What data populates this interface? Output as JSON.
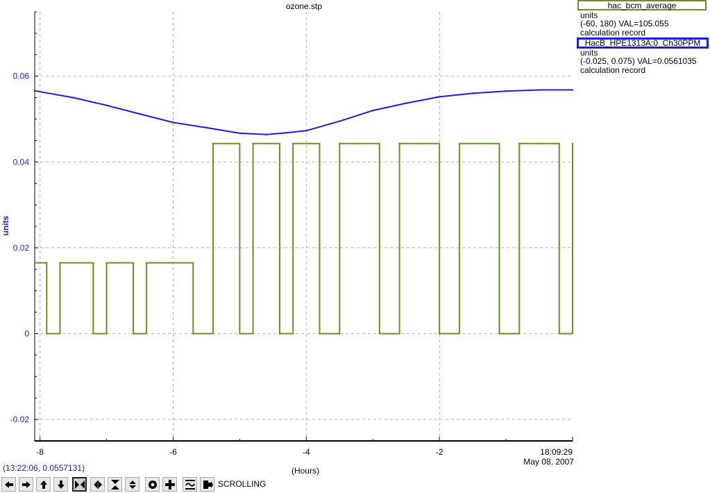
{
  "chart_data": {
    "type": "line",
    "title": "ozone.stp",
    "xlabel": "(Hours)",
    "ylabel": "units",
    "xlim": [
      -8.08,
      0
    ],
    "ylim": [
      -0.025,
      0.075
    ],
    "x_ticks": [
      -8,
      -6,
      -4,
      -2
    ],
    "x_tick_labels": [
      "-8",
      "-6",
      "-4",
      "-2"
    ],
    "y_ticks": [
      -0.02,
      0,
      0.02,
      0.04,
      0.06
    ],
    "y_tick_labels": [
      "-0.02",
      "0",
      "0.02",
      "0.04",
      "0.06"
    ],
    "end_time": "18:09:29",
    "end_date": "May 08, 2007",
    "grid": true,
    "series": [
      {
        "name": "HacB_HPE1313A:0_Ch30PPM",
        "color": "#1a1ae6",
        "x": [
          -8.08,
          -7.5,
          -7.0,
          -6.5,
          -6.0,
          -5.5,
          -5.0,
          -4.6,
          -4.3,
          -4.0,
          -3.5,
          -3.0,
          -2.5,
          -2.0,
          -1.5,
          -1.0,
          -0.5,
          0
        ],
        "values": [
          0.0566,
          0.055,
          0.0532,
          0.0512,
          0.0492,
          0.048,
          0.0467,
          0.0464,
          0.0468,
          0.0473,
          0.0495,
          0.052,
          0.0537,
          0.0552,
          0.056,
          0.0565,
          0.0568,
          0.0568
        ]
      },
      {
        "name": "hac_bcm_average",
        "color": "#6b8e23",
        "x": [
          -8.08,
          -7.9,
          -7.7,
          -7.5,
          -7.2,
          -7.0,
          -6.6,
          -6.4,
          -6.0,
          -5.7,
          -5.45,
          -5.4,
          -5.2,
          -5.0,
          -4.8,
          -4.6,
          -4.4,
          -4.2,
          -4.0,
          -3.8,
          -3.5,
          -3.2,
          -2.9,
          -2.6,
          -2.3,
          -2.0,
          -1.7,
          -1.4,
          -1.1,
          -0.8,
          -0.5,
          -0.2,
          0
        ],
        "values": [
          0.0165,
          0,
          0.0165,
          0.0165,
          0,
          0.0165,
          0,
          0.0165,
          0.0165,
          0,
          0,
          0.0443,
          0.0443,
          0,
          0.0443,
          0.0443,
          0,
          0.0443,
          0.0443,
          0,
          0.0443,
          0.0443,
          0,
          0.0443,
          0.0443,
          0,
          0.0443,
          0.0443,
          0,
          0.0443,
          0.0443,
          0,
          0.0443
        ]
      }
    ]
  },
  "legend": {
    "item1": {
      "name": "hac_bcm_average",
      "units": "units",
      "range": "(-60, 180) VAL=105.055",
      "desc": "calculation record",
      "color": "#6b8e23"
    },
    "item2": {
      "name": "HacB_HPE1313A:0_Ch30PPM",
      "units": "units",
      "range": "(-0.025, 0.075) VAL=0.0561035",
      "desc": "calculation record",
      "color": "#1a1ae6"
    }
  },
  "cursor_readout": "(13:22:06, 0.0557131)",
  "toolbar": {
    "buttons": [
      "arrow-left-icon",
      "arrow-right-icon",
      "arrow-up-icon",
      "arrow-down-icon",
      "zoom-in-x-icon",
      "zoom-out-x-icon",
      "zoom-in-y-icon",
      "zoom-out-y-icon",
      "reset-icon",
      "crosshair-icon",
      "autoscale-icon",
      "export-icon"
    ],
    "mode_label": "SCROLLING"
  }
}
